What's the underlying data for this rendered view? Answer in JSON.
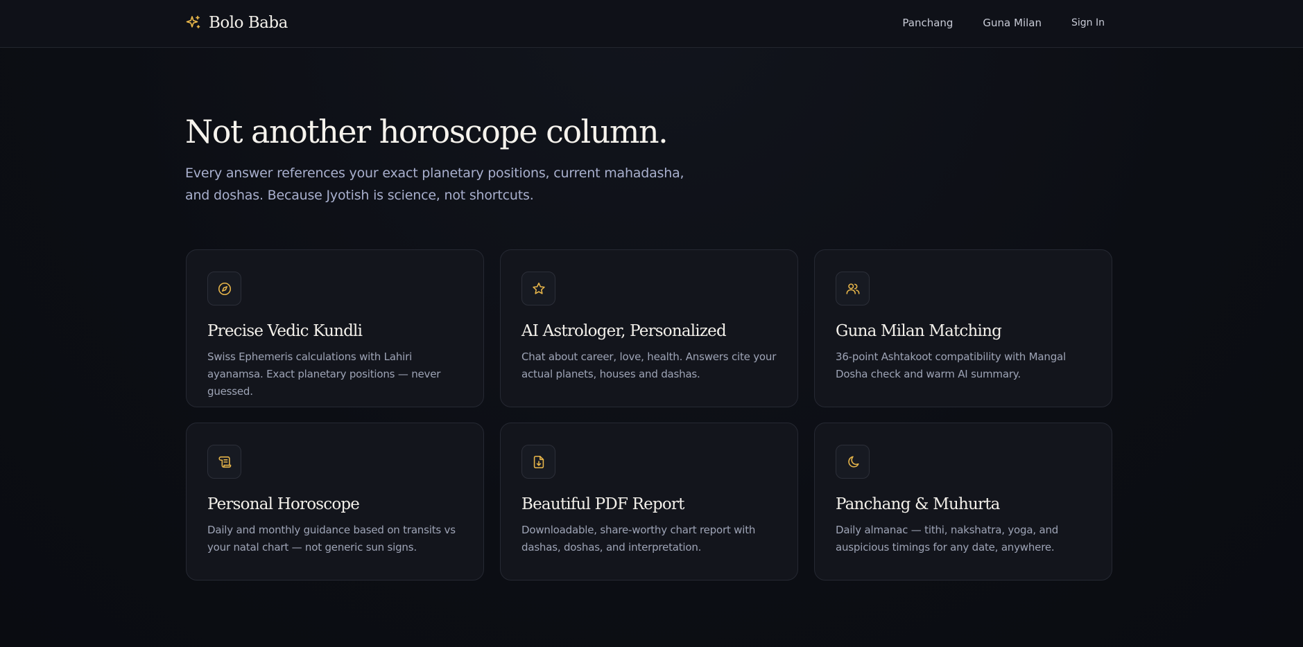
{
  "colors": {
    "accent": "#e8b64a",
    "background": "#0c0e14",
    "card": "#13151c"
  },
  "header": {
    "brand_icon": "sparkles-icon",
    "brand_name": "Bolo Baba",
    "nav": [
      {
        "label": "Panchang"
      },
      {
        "label": "Guna Milan"
      },
      {
        "label": "Sign In"
      }
    ]
  },
  "hero": {
    "title": "Not another horoscope column.",
    "subtitle": "Every answer references your exact planetary positions, current mahadasha, and doshas. Because Jyotish is science, not shortcuts."
  },
  "features": [
    {
      "icon": "compass-icon",
      "title": "Precise Vedic Kundli",
      "description": "Swiss Ephemeris calculations with Lahiri ayanamsa. Exact planetary positions — never guessed."
    },
    {
      "icon": "star-icon",
      "title": "AI Astrologer, Personalized",
      "description": "Chat about career, love, health. Answers cite your actual planets, houses and dashas."
    },
    {
      "icon": "users-icon",
      "title": "Guna Milan Matching",
      "description": "36-point Ashtakoot compatibility with Mangal Dosha check and warm AI summary."
    },
    {
      "icon": "scroll-icon",
      "title": "Personal Horoscope",
      "description": "Daily and monthly guidance based on transits vs your natal chart — not generic sun signs."
    },
    {
      "icon": "file-download-icon",
      "title": "Beautiful PDF Report",
      "description": "Downloadable, share-worthy chart report with dashas, doshas, and interpretation."
    },
    {
      "icon": "moon-icon",
      "title": "Panchang & Muhurta",
      "description": "Daily almanac — tithi, nakshatra, yoga, and auspicious timings for any date, anywhere."
    }
  ]
}
